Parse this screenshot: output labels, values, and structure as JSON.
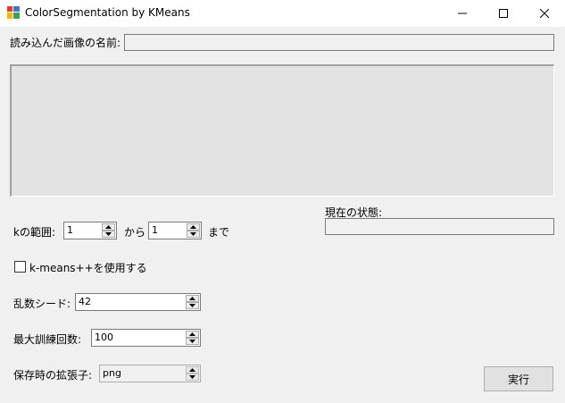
{
  "window": {
    "title": "ColorSegmentation by KMeans",
    "minimize_icon": "minimize-icon",
    "maximize_icon": "maximize-icon",
    "close_icon": "close-icon"
  },
  "file_name": {
    "label": "読み込んだ画像の名前:",
    "value": ""
  },
  "status": {
    "label": "現在の状態:",
    "value": ""
  },
  "k_range": {
    "label": "kの範囲:",
    "from_value": "1",
    "from_text": "から",
    "to_value": "1",
    "to_text": "まで"
  },
  "kmeanspp": {
    "label": "k-means++を使用する",
    "checked": false
  },
  "seed": {
    "label": "乱数シード:",
    "value": "42"
  },
  "max_iter": {
    "label": "最大訓練回数:",
    "value": "100"
  },
  "extension": {
    "label": "保存時の拡張子:",
    "value": "png"
  },
  "run_button": {
    "label": "実行"
  }
}
